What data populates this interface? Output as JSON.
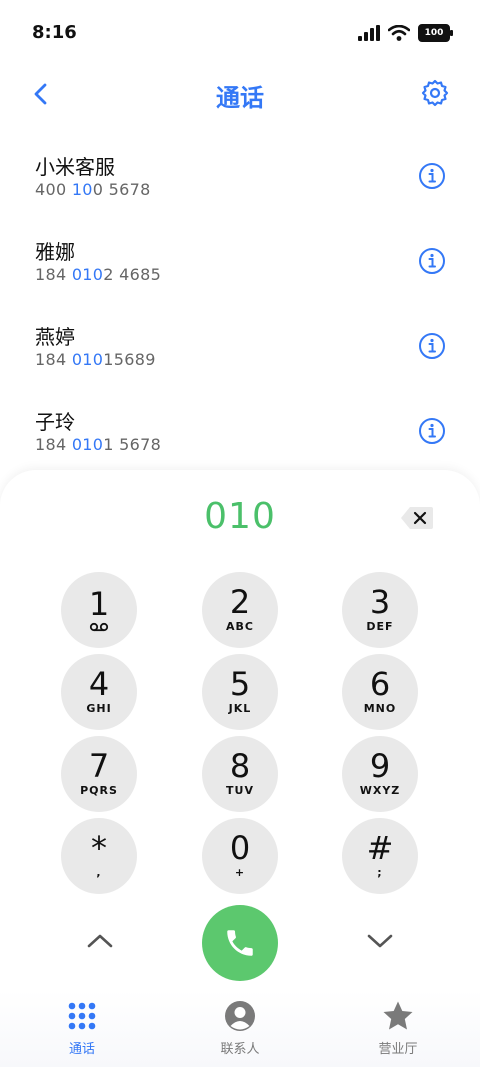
{
  "status_bar": {
    "time": "8:16",
    "battery": "100"
  },
  "header": {
    "title": "通话"
  },
  "contacts": [
    {
      "name": "小米客服",
      "number_pre": "400 ",
      "number_hl": "10",
      "number_post": "0 5678"
    },
    {
      "name": "雅娜",
      "number_pre": "184 ",
      "number_hl": "010",
      "number_post": "2 4685"
    },
    {
      "name": "燕婷",
      "number_pre": "184 ",
      "number_hl": "010",
      "number_post": "15689"
    },
    {
      "name": "子玲",
      "number_pre": "184 ",
      "number_hl": "010",
      "number_post": "1 5678"
    }
  ],
  "dialer": {
    "entered": "010",
    "keys": [
      {
        "digit": "1",
        "letters": ""
      },
      {
        "digit": "2",
        "letters": "ABC"
      },
      {
        "digit": "3",
        "letters": "DEF"
      },
      {
        "digit": "4",
        "letters": "GHI"
      },
      {
        "digit": "5",
        "letters": "JKL"
      },
      {
        "digit": "6",
        "letters": "MNO"
      },
      {
        "digit": "7",
        "letters": "PQRS"
      },
      {
        "digit": "8",
        "letters": "TUV"
      },
      {
        "digit": "9",
        "letters": "WXYZ"
      },
      {
        "digit": "*",
        "letters": ","
      },
      {
        "digit": "0",
        "letters": "+"
      },
      {
        "digit": "#",
        "letters": ";"
      }
    ]
  },
  "tabs": [
    {
      "label": "通话",
      "icon": "dialpad-icon",
      "active": true
    },
    {
      "label": "联系人",
      "icon": "contact-person-icon",
      "active": false
    },
    {
      "label": "营业厅",
      "icon": "star-icon",
      "active": false
    }
  ],
  "colors": {
    "accent": "#3478f6",
    "dial_green": "#4bc06a",
    "call_button": "#5cc86e",
    "key_bg": "#e9e9e9"
  }
}
